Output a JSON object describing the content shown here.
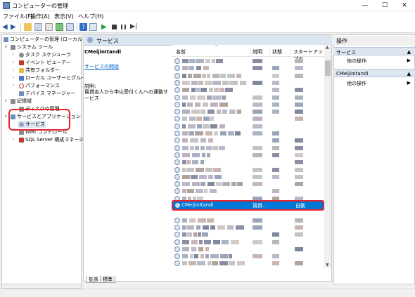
{
  "window": {
    "title": "コンピューターの管理",
    "minimize": "—",
    "maximize": "☐",
    "close": "✕"
  },
  "menu": [
    "ファイル(F)",
    "操作(A)",
    "表示(V)",
    "ヘルプ(H)"
  ],
  "tree": {
    "items": [
      {
        "label": "コンピューターの管理 (ローカル)",
        "expander": "",
        "color": "#6b8fbf"
      },
      {
        "label": "システム ツール",
        "expander": "∨",
        "color": "#8c8c8c"
      },
      {
        "label": "タスク スケジューラ",
        "expander": "›",
        "color": "#8c8c8c"
      },
      {
        "label": "イベント ビューアー",
        "expander": "›",
        "color": "#c0392b"
      },
      {
        "label": "共有フォルダー",
        "expander": "›",
        "color": "#e8b84a"
      },
      {
        "label": "ローカル ユーザーとグループ",
        "expander": "›",
        "color": "#4a7bbf"
      },
      {
        "label": "パフォーマンス",
        "expander": "›",
        "color": "#c0392b"
      },
      {
        "label": "デバイス マネージャー",
        "expander": "",
        "color": "#6b8fbf"
      },
      {
        "label": "記憶域",
        "expander": "∨",
        "color": "#8c8c8c"
      },
      {
        "label": "ディスクの管理",
        "expander": "",
        "color": "#8c8c8c"
      },
      {
        "label": "サービスとアプリケーション",
        "expander": "∨",
        "color": "#6b8fbf"
      },
      {
        "label": "サービス",
        "expander": "",
        "color": "#8fa9c9"
      },
      {
        "label": "WMI コントロール",
        "expander": "",
        "color": "#8c8c8c"
      },
      {
        "label": "SQL Server 構成マネージャー",
        "expander": "›",
        "color": "#c0392b"
      }
    ]
  },
  "main": {
    "header": "サービス",
    "service_name": "CMeijinItandi",
    "start_link": "サービスの開始",
    "desc_label": "説明:",
    "desc_text": "賃貸名人から申込受付くんへの連動サービス",
    "columns": [
      "名前",
      "説明",
      "状態",
      "スタートアップの"
    ],
    "selected": {
      "name": "CMeijinItandi",
      "desc": "賃貸...",
      "startup": "自動"
    },
    "tabs": [
      "拡張",
      "標準"
    ]
  },
  "actions": {
    "title": "操作",
    "sections": [
      {
        "label": "サービス",
        "item": "他の操作"
      },
      {
        "label": "CMeijinItandi",
        "item": "他の操作"
      }
    ],
    "arrow": "▶",
    "collapse": "▲"
  }
}
